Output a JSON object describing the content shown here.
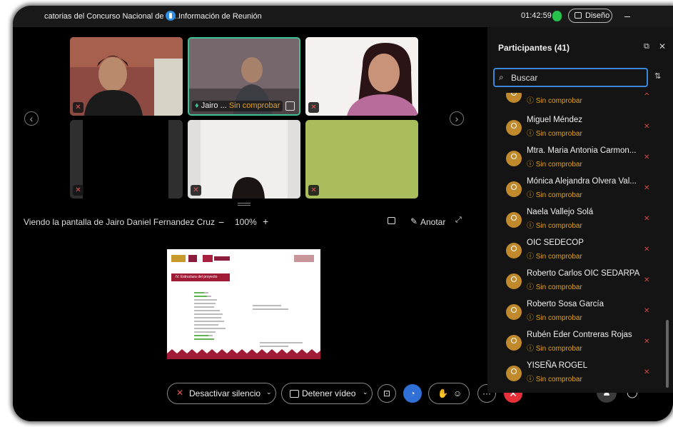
{
  "titlebar": {
    "meeting_title": "catorias del Concurso Nacional de Tr...",
    "info_label": "Información de Reunión",
    "time": "01:42:59",
    "design_label": "Diseño"
  },
  "tiles": [
    {
      "name": "",
      "status": ""
    },
    {
      "name": "Jairo ...",
      "status": "Sin comprobar"
    },
    {
      "name": "",
      "status": ""
    }
  ],
  "share": {
    "viewing": "Viendo la pantalla de Jairo Daniel Fernandez Cruz",
    "zoom": "100%",
    "annotate": "Anotar"
  },
  "slide": {
    "heading": "IV. Estructura del proyecto"
  },
  "toolbar": {
    "mute_label": "Desactivar silencio",
    "video_label": "Detener vídeo"
  },
  "participants": {
    "title": "Participantes (41)",
    "search_placeholder": "Buscar",
    "items": [
      {
        "name": "",
        "status": "Sin comprobar"
      },
      {
        "name": "Miguel Méndez",
        "status": "Sin comprobar"
      },
      {
        "name": "Mtra. Maria Antonia Carmon...",
        "status": "Sin comprobar"
      },
      {
        "name": "Mónica Alejandra Olvera Val...",
        "status": "Sin comprobar"
      },
      {
        "name": "Naela Vallejo Solá",
        "status": "Sin comprobar"
      },
      {
        "name": "OIC SEDECOP",
        "status": "Sin comprobar"
      },
      {
        "name": "Roberto Carlos OIC SEDARPA",
        "status": "Sin comprobar"
      },
      {
        "name": "Roberto Sosa García",
        "status": "Sin comprobar"
      },
      {
        "name": "Rubén Eder Contreras Rojas",
        "status": "Sin comprobar"
      },
      {
        "name": "YISEÑA ROGEL",
        "status": "Sin comprobar"
      }
    ]
  },
  "colors": {
    "accent": "#3b87d8",
    "warning": "#e0a020",
    "muted_red": "#d84a4a",
    "leave_red": "#e8303a"
  }
}
